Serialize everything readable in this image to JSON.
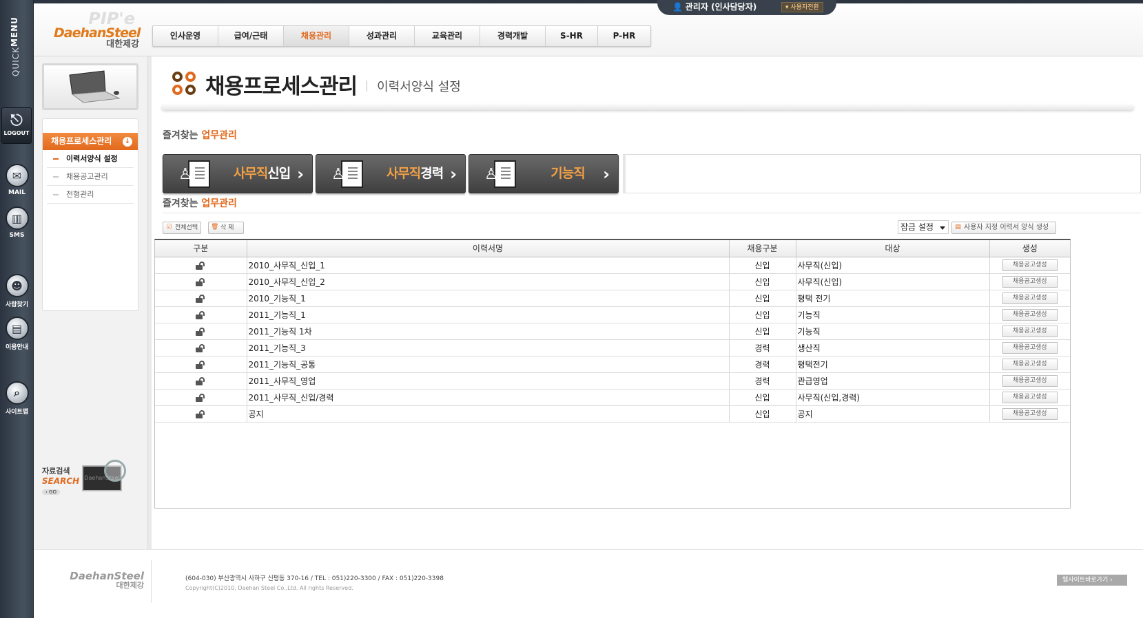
{
  "quick_menu": {
    "title_thin": "QUICK",
    "title_bold": "MENU",
    "logout": "LOGOUT",
    "items": [
      {
        "label": "MAIL",
        "icon": "mail-icon"
      },
      {
        "label": "SMS",
        "icon": "sms-icon"
      },
      {
        "label": "사람찾기",
        "icon": "people-search-icon"
      },
      {
        "label": "이용안내",
        "icon": "guide-book-icon"
      },
      {
        "label": "사이트맵",
        "icon": "sitemap-search-icon"
      }
    ]
  },
  "logo": {
    "product": "PIP'e",
    "brand": "DaehanSteel",
    "brand_kr": "대한제강"
  },
  "user": {
    "name": "관리자 (인사담당자)",
    "switch_label": "사용자전환"
  },
  "nav": {
    "items": [
      "인사운영",
      "급여/근태",
      "채용관리",
      "성과관리",
      "교육관리",
      "경력개발",
      "S-HR",
      "P-HR"
    ],
    "active": "채용관리"
  },
  "sidebar": {
    "menu_title": "채용프로세스관리",
    "items": [
      {
        "label": "이력서양식 설정",
        "active": true
      },
      {
        "label": "채용공고관리",
        "active": false
      },
      {
        "label": "전형관리",
        "active": false
      }
    ],
    "search": {
      "label_kr": "자료검색",
      "label_en": "SEARCH",
      "go": "GO",
      "monitor_text": "DaehanSteel"
    }
  },
  "page": {
    "title": "채용프로세스관리",
    "subtitle": "이력서양식 설정"
  },
  "favorites_section": {
    "prefix": "즐겨찾는",
    "highlight": "업무관리"
  },
  "favorites": [
    {
      "lead": "사무직",
      "tail": "신입"
    },
    {
      "lead": "사무직",
      "tail": "경력"
    },
    {
      "lead": "",
      "tail": "기능직"
    }
  ],
  "list_section": {
    "prefix": "즐겨찾는",
    "highlight": "업무관리"
  },
  "toolbar": {
    "select_all": "전체선택",
    "delete": "삭 제",
    "lock_select": "잠금 설정",
    "custom_create": "사용자 지정 이력서 양식 생성"
  },
  "table": {
    "headers": [
      "구분",
      "이력서명",
      "채용구분",
      "대상",
      "생성"
    ],
    "button_label": "채용공고생성",
    "rows": [
      {
        "name": "2010_사무직_신입_1",
        "type": "신입",
        "target": "사무직(신입)"
      },
      {
        "name": "2010_사무직_신입_2",
        "type": "신입",
        "target": "사무직(신입)"
      },
      {
        "name": "2010_기능직_1",
        "type": "신입",
        "target": "평택 전기"
      },
      {
        "name": "2011_기능직_1",
        "type": "신입",
        "target": "기능직"
      },
      {
        "name": "2011_기능직 1차",
        "type": "신입",
        "target": "기능직"
      },
      {
        "name": "2011_기능직_3",
        "type": "경력",
        "target": "생산직"
      },
      {
        "name": "2011_기능직_공통",
        "type": "경력",
        "target": "평택전기"
      },
      {
        "name": "2011_사무직_영업",
        "type": "경력",
        "target": "관급영업"
      },
      {
        "name": "2011_사무직_신입/경력",
        "type": "신입",
        "target": "사무직(신입,경력)"
      },
      {
        "name": "공지",
        "type": "신입",
        "target": "공지"
      }
    ]
  },
  "footer": {
    "logo_en": "DaehanSteel",
    "logo_kr": "대한제강",
    "address": "(604-030) 부산광역시 사하구 신평동 370-16   /   TEL : 051)220-3300   /   FAX : 051)220-3398",
    "copyright": "Copyright(C)2010, Daehan Steel Co.,Ltd. All rights Reserved.",
    "site_link": "웹사이트바로가기 ›"
  },
  "colors": {
    "accent": "#e2691c",
    "dark": "#39424c"
  }
}
